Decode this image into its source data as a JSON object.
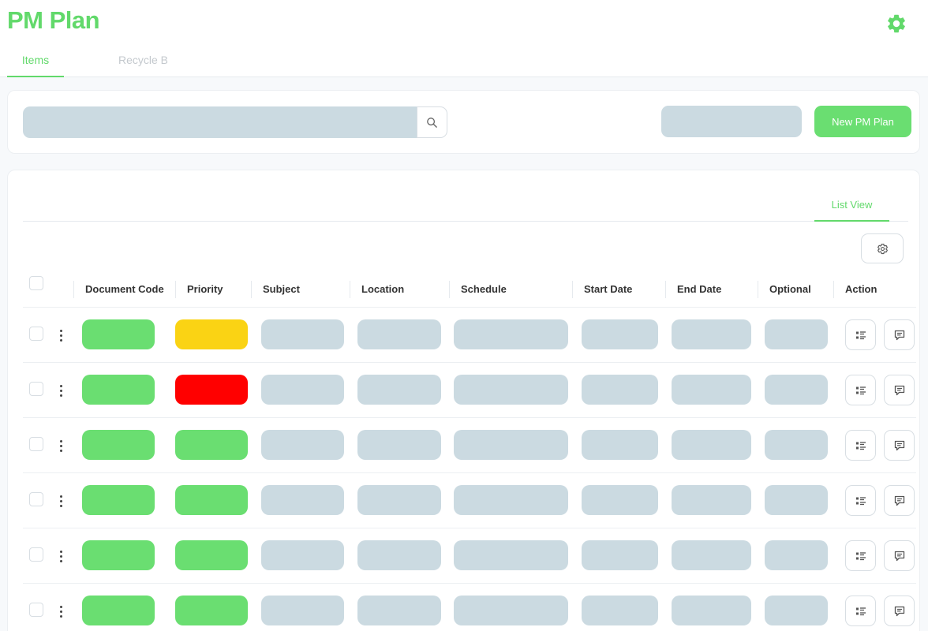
{
  "app": {
    "title": "PM Plan"
  },
  "tabs": [
    {
      "label": "Items",
      "active": true
    },
    {
      "label": "Recycle B",
      "active": false
    }
  ],
  "toolbar": {
    "search_value": "",
    "new_button_label": "New PM Plan"
  },
  "list": {
    "view_tab_label": "List View",
    "columns": [
      "Document Code",
      "Priority",
      "Subject",
      "Location",
      "Schedule",
      "Start Date",
      "End Date",
      "Optional",
      "Action"
    ],
    "rows": [
      {
        "document_code_color": "#6ade71",
        "priority_color": "#fad314"
      },
      {
        "document_code_color": "#6ade71",
        "priority_color": "#ff0000"
      },
      {
        "document_code_color": "#6ade71",
        "priority_color": "#6ade71"
      },
      {
        "document_code_color": "#6ade71",
        "priority_color": "#6ade71"
      },
      {
        "document_code_color": "#6ade71",
        "priority_color": "#6ade71"
      },
      {
        "document_code_color": "#6ade71",
        "priority_color": "#6ade71"
      }
    ],
    "placeholder_color": "#cbdae1"
  },
  "icons": {
    "settings": "gear-icon",
    "search": "search-icon",
    "column_settings": "gear-icon",
    "row_menu": "kebab-icon",
    "row_details": "list-details-icon",
    "row_comment": "comment-icon"
  },
  "colors": {
    "accent": "#62d96b",
    "button_green": "#6ade71",
    "placeholder": "#cbdae1"
  }
}
